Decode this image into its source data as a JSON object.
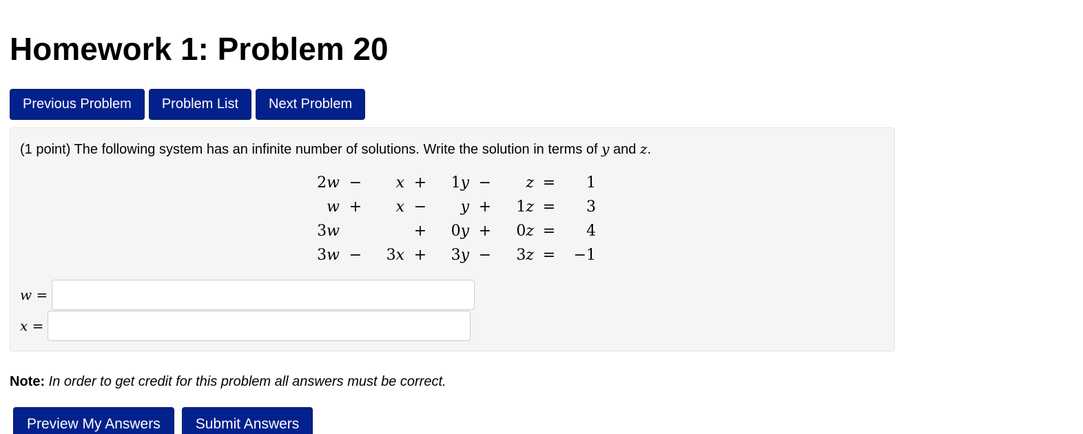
{
  "header": {
    "title": "Homework 1: Problem 20"
  },
  "nav": {
    "previous_label": "Previous Problem",
    "list_label": "Problem List",
    "next_label": "Next Problem"
  },
  "problem": {
    "points": "(1 point)",
    "prompt_main": "The following system has an infinite number of solutions. Write the solution in terms of",
    "var_y": "y",
    "conj": "and",
    "var_z": "z",
    "end": ".",
    "system": [
      [
        "2w",
        "−",
        "x",
        "+",
        "1y",
        "−",
        "z",
        "=",
        "1"
      ],
      [
        "w",
        "+",
        "x",
        "−",
        "y",
        "+",
        "1z",
        "=",
        "3"
      ],
      [
        "3w",
        "",
        "",
        "+",
        "0y",
        "+",
        "0z",
        "=",
        "4"
      ],
      [
        "3w",
        "−",
        "3x",
        "+",
        "3y",
        "−",
        "3z",
        "=",
        "−1"
      ]
    ],
    "answers": [
      {
        "label": "w =",
        "value": "",
        "placeholder": ""
      },
      {
        "label": "x =",
        "value": "",
        "placeholder": ""
      }
    ]
  },
  "note": {
    "label": "Note:",
    "text": "In order to get credit for this problem all answers must be correct."
  },
  "actions": {
    "preview_label": "Preview My Answers",
    "submit_label": "Submit Answers"
  }
}
